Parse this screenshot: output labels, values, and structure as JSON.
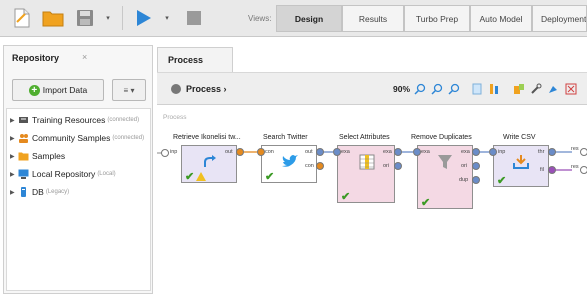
{
  "toolbar": {
    "views_label": "Views:",
    "view_tabs": [
      "Design",
      "Results",
      "Turbo Prep",
      "Auto Model",
      "Deployment"
    ],
    "active_view": "Design",
    "colors": {
      "accent_blue": "#2d86d6",
      "folder_orange": "#f0a21f"
    }
  },
  "repository": {
    "title": "Repository",
    "close_symbol": "×",
    "import_label": "Import Data",
    "menu_label": "≡ ▾",
    "items": [
      {
        "label": "Training Resources",
        "sub": "(connected)",
        "icon": "training-resources-icon"
      },
      {
        "label": "Community Samples",
        "sub": "(connected)",
        "icon": "community-icon"
      },
      {
        "label": "Samples",
        "sub": "",
        "icon": "folder-icon"
      },
      {
        "label": "Local Repository",
        "sub": "(Local)",
        "icon": "local-repository-icon"
      },
      {
        "label": "DB",
        "sub": "(Legacy)",
        "icon": "database-icon"
      }
    ]
  },
  "process": {
    "tab_label": "Process",
    "breadcrumb": "Process ›",
    "zoom": "90%",
    "canvas_label": "Process",
    "operators": [
      {
        "title": "Retrieve Ikonelisi tw...",
        "in_ports": [
          "inp"
        ],
        "out_ports": [
          "out"
        ],
        "icon": "retrieve-icon"
      },
      {
        "title": "Search Twitter",
        "in_ports": [
          "con"
        ],
        "out_ports": [
          "out",
          "con"
        ],
        "icon": "twitter-icon"
      },
      {
        "title": "Select Attributes",
        "in_ports": [
          "exa"
        ],
        "out_ports": [
          "exa",
          "ori"
        ],
        "icon": "select-attributes-icon"
      },
      {
        "title": "Remove Duplicates",
        "in_ports": [
          "exa"
        ],
        "out_ports": [
          "exa",
          "ori",
          "dup"
        ],
        "icon": "filter-icon"
      },
      {
        "title": "Write CSV",
        "in_ports": [
          "inp"
        ],
        "out_ports": [
          "thr",
          "fil"
        ],
        "icon": "write-csv-icon"
      }
    ],
    "result_ports": [
      "res",
      "res"
    ]
  }
}
